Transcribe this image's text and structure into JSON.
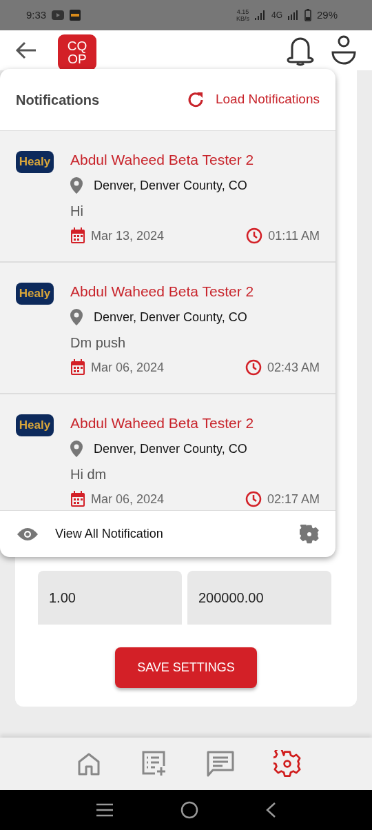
{
  "status_bar": {
    "time": "9:33",
    "speed": "4.15",
    "speed_unit": "KB/s",
    "network": "4G",
    "battery": "29%"
  },
  "header": {
    "logo_lines": [
      "CQ",
      "OP"
    ]
  },
  "notifications": {
    "title": "Notifications",
    "load_label": "Load Notifications",
    "items": [
      {
        "logo_text": "Healy",
        "sender": "Abdul Waheed Beta Tester 2",
        "location": "Denver, Denver County, CO",
        "message": "Hi",
        "date": "Mar 13, 2024",
        "time": "01:11 AM"
      },
      {
        "logo_text": "Healy",
        "sender": "Abdul Waheed Beta Tester 2",
        "location": "Denver, Denver County, CO",
        "message": "Dm push",
        "date": "Mar 06, 2024",
        "time": "02:43 AM"
      },
      {
        "logo_text": "Healy",
        "sender": "Abdul Waheed Beta Tester 2",
        "location": "Denver, Denver County, CO",
        "message": "Hi dm",
        "date": "Mar 06, 2024",
        "time": "02:17 AM"
      }
    ],
    "footer_label": "View All Notification"
  },
  "settings": {
    "fields": [
      {
        "value": "1.00"
      },
      {
        "value": "200000.00"
      }
    ],
    "save_label": "SAVE SETTINGS"
  },
  "bottom_nav": [
    {
      "kind": "home",
      "selected": false
    },
    {
      "kind": "list-add",
      "selected": false
    },
    {
      "kind": "chat",
      "selected": false
    },
    {
      "kind": "settings",
      "selected": true
    }
  ]
}
